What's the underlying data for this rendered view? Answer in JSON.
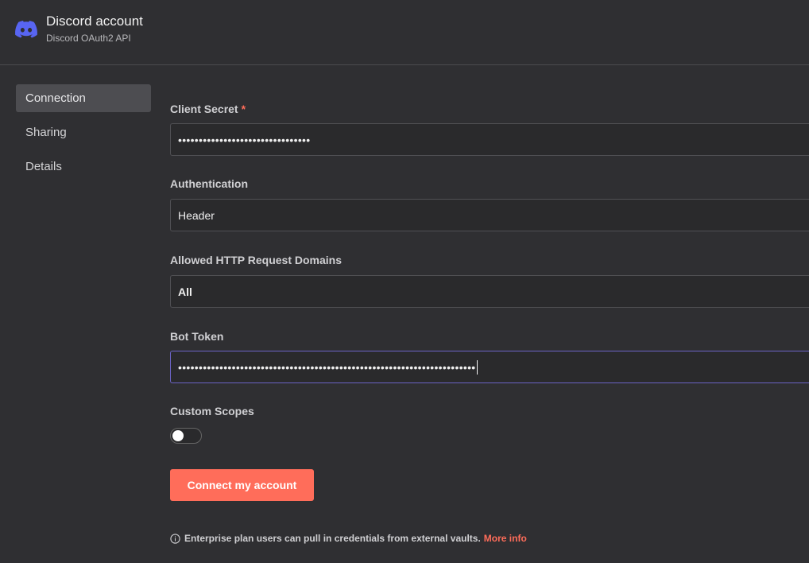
{
  "header": {
    "title": "Discord account",
    "subtitle": "Discord OAuth2 API",
    "logo_icon": "discord-logo-icon",
    "logo_color": "#5865f2"
  },
  "sidebar": {
    "items": [
      {
        "label": "Connection",
        "active": true
      },
      {
        "label": "Sharing",
        "active": false
      },
      {
        "label": "Details",
        "active": false
      }
    ]
  },
  "form": {
    "client_secret": {
      "label": "Client Secret",
      "required_marker": "*",
      "value": "••••••••••••••••••••••••••••••••"
    },
    "authentication": {
      "label": "Authentication",
      "value": "Header"
    },
    "allowed_domains": {
      "label": "Allowed HTTP Request Domains",
      "value": "All"
    },
    "bot_token": {
      "label": "Bot Token",
      "value": "••••••••••••••••••••••••••••••••••••••••••••••••••••••••••••••••••••••••"
    },
    "custom_scopes": {
      "label": "Custom Scopes",
      "enabled": false
    }
  },
  "connect_button": {
    "label": "Connect my account"
  },
  "info": {
    "text": "Enterprise plan users can pull in credentials from external vaults.",
    "link": "More info",
    "icon": "info-circle-icon"
  },
  "colors": {
    "accent": "#ff6d5a",
    "focus": "#6b63c4",
    "background": "#2f2f32"
  }
}
